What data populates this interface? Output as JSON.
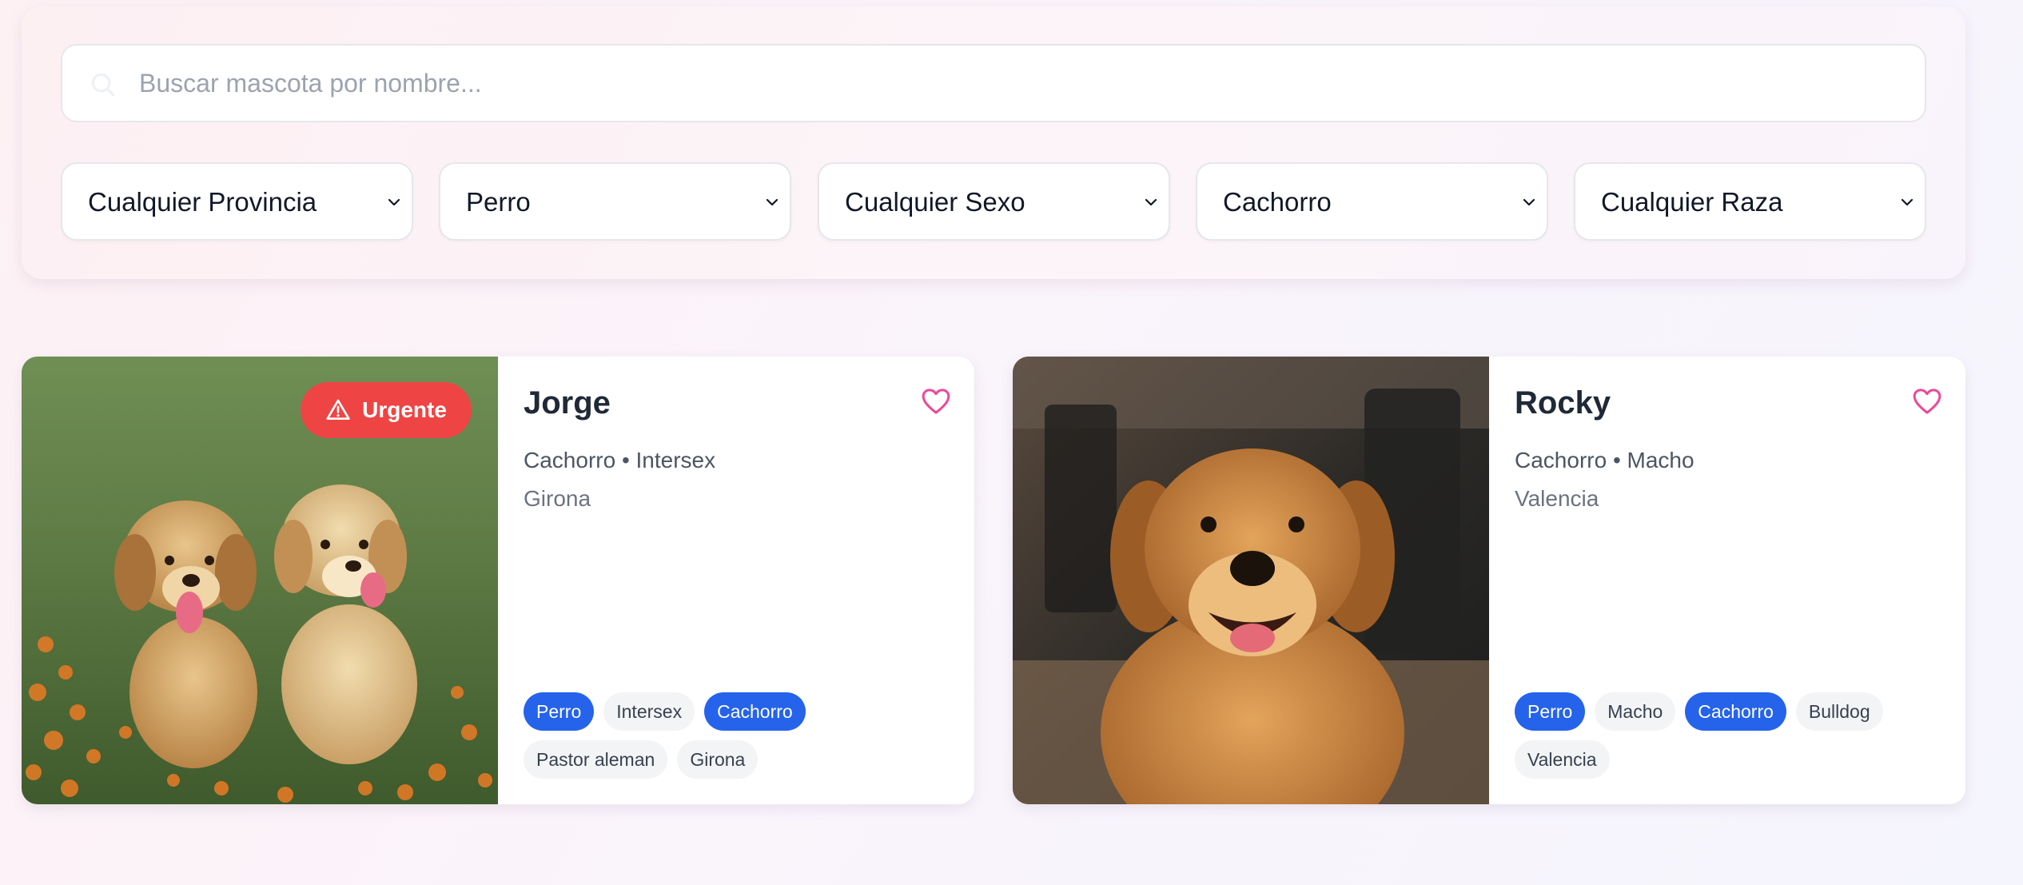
{
  "search": {
    "placeholder": "Buscar mascota por nombre..."
  },
  "filters": [
    {
      "name": "filter-provincia",
      "value": "Cualquier Provincia"
    },
    {
      "name": "filter-especie",
      "value": "Perro"
    },
    {
      "name": "filter-sexo",
      "value": "Cualquier Sexo"
    },
    {
      "name": "filter-edad",
      "value": "Cachorro"
    },
    {
      "name": "filter-raza",
      "value": "Cualquier Raza"
    }
  ],
  "cards": [
    {
      "name": "Jorge",
      "meta": "Cachorro • Intersex",
      "location": "Girona",
      "urgent": "Urgente",
      "tags": [
        {
          "label": "Perro",
          "primary": true
        },
        {
          "label": "Intersex",
          "primary": false
        },
        {
          "label": "Cachorro",
          "primary": true
        },
        {
          "label": "Pastor aleman",
          "primary": false
        },
        {
          "label": "Girona",
          "primary": false
        }
      ]
    },
    {
      "name": "Rocky",
      "meta": "Cachorro • Macho",
      "location": "Valencia",
      "tags": [
        {
          "label": "Perro",
          "primary": true
        },
        {
          "label": "Macho",
          "primary": false
        },
        {
          "label": "Cachorro",
          "primary": true
        },
        {
          "label": "Bulldog",
          "primary": false
        },
        {
          "label": "Valencia",
          "primary": false
        }
      ]
    }
  ],
  "colors": {
    "accent": "#2563eb",
    "urgent": "#ef4444",
    "favorite": "#ec4899"
  },
  "icons": [
    "search-icon",
    "chevron-down-icon",
    "warning-triangle-icon",
    "heart-icon"
  ]
}
